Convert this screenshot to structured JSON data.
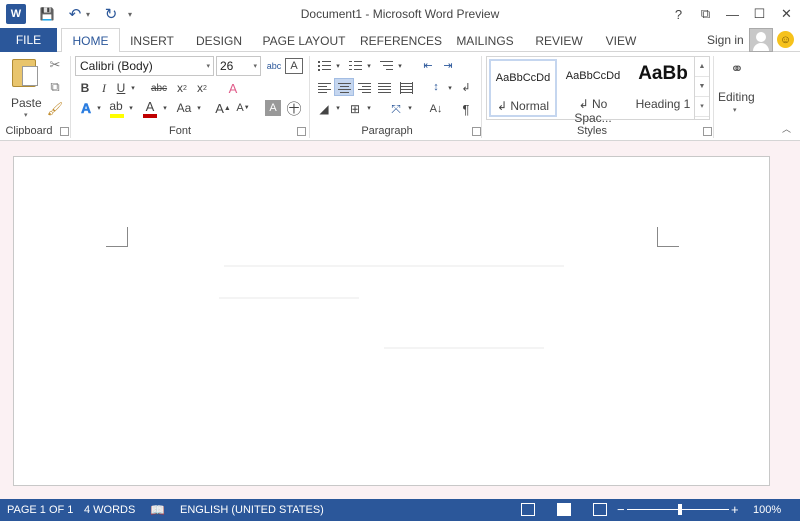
{
  "window": {
    "title": "Document1 - Microsoft Word Preview",
    "app_icon_letter": "W",
    "controls": [
      "?",
      "⧉",
      "—",
      "☐",
      "✕"
    ]
  },
  "qat": {
    "save": "💾",
    "undo": "↶",
    "redo": "↻",
    "customize": "▾"
  },
  "tabs": [
    {
      "label": "FILE"
    },
    {
      "label": "HOME"
    },
    {
      "label": "INSERT"
    },
    {
      "label": "DESIGN"
    },
    {
      "label": "PAGE LAYOUT"
    },
    {
      "label": "REFERENCES"
    },
    {
      "label": "MAILINGS"
    },
    {
      "label": "REVIEW"
    },
    {
      "label": "VIEW"
    }
  ],
  "account": {
    "signin": "Sign in"
  },
  "ribbon": {
    "clipboard": {
      "label": "Clipboard",
      "paste_label": "Paste"
    },
    "font": {
      "label": "Font",
      "font_name": "Calibri (Body)",
      "font_size": "26",
      "bold": "B",
      "italic": "I",
      "underline": "U",
      "strike": "abc",
      "subscript": "x",
      "superscript": "x",
      "font_color_letter": "A",
      "change_case": "Aa",
      "grow": "A",
      "shrink": "A",
      "clear": "A",
      "shading": "A",
      "phonetic": "abc"
    },
    "paragraph": {
      "label": "Paragraph"
    },
    "styles": {
      "label": "Styles",
      "items": [
        {
          "sample": "AaBbCcDd",
          "name": "↲ Normal"
        },
        {
          "sample": "AaBbCcDd",
          "name": "↲ No Spac..."
        },
        {
          "sample": "AaBb",
          "name": "Heading 1"
        }
      ]
    },
    "editing": {
      "label": "Editing"
    }
  },
  "status": {
    "page": "PAGE 1 OF 1",
    "words": "4 WORDS",
    "language": "ENGLISH (UNITED STATES)",
    "zoom_minus": "−",
    "zoom_plus": "+",
    "zoom": "100%"
  },
  "colors": {
    "accent": "#2b579a",
    "highlight": "#ffff00",
    "font_color": "#c00000",
    "document_bg": "#fbf1f3"
  }
}
